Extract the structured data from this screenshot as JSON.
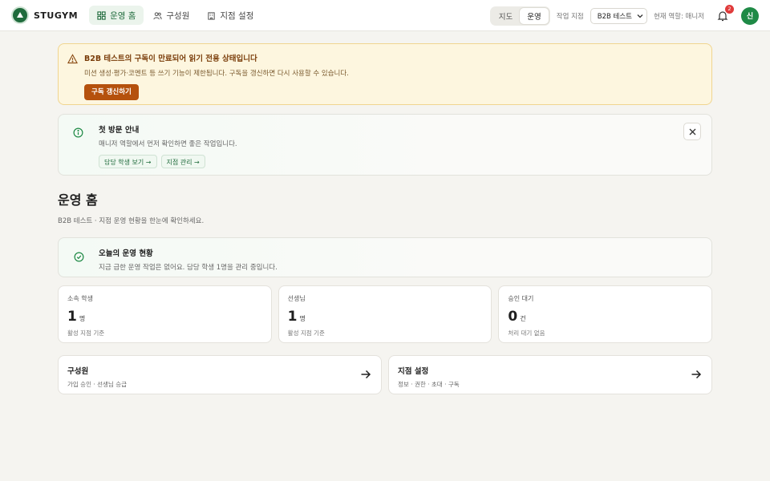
{
  "brand": {
    "name": "STUGYM"
  },
  "nav": {
    "items": [
      {
        "label": "운영 홈",
        "icon": "grid-icon",
        "active": true
      },
      {
        "label": "구성원",
        "icon": "users-icon",
        "active": false
      },
      {
        "label": "지점 설정",
        "icon": "building-icon",
        "active": false
      }
    ]
  },
  "header": {
    "mode_tabs": [
      "지도",
      "운영"
    ],
    "active_mode": "운영",
    "branch_label": "작업 지점",
    "branch_value": "B2B 테스트",
    "role_label": "현재 역할: 매니저",
    "notification_count": "2",
    "avatar_initial": "신"
  },
  "warning": {
    "title": "B2B 테스트의 구독이 만료되어 읽기 전용 상태입니다",
    "desc": "미션 생성·평가·코멘트 등 쓰기 기능이 제한됩니다. 구독을 갱신하면 다시 사용할 수 있습니다.",
    "button": "구독 갱신하기"
  },
  "guide": {
    "title": "첫 방문 안내",
    "desc": "매니저 역할에서 먼저 확인하면 좋은 작업입니다.",
    "chips": [
      "담당 학생 보기 →",
      "지점 관리 →"
    ]
  },
  "page": {
    "title": "운영 홈",
    "subtitle": "B2B 테스트 · 지점 운영 현황을 한눈에 확인하세요."
  },
  "status": {
    "title": "오늘의 운영 현황",
    "desc": "지금 급한 운영 작업은 없어요. 담당 학생 1명을 관리 중입니다."
  },
  "stats": [
    {
      "label": "소속 학생",
      "value": "1",
      "unit": "명",
      "note": "활성 지점 기준"
    },
    {
      "label": "선생님",
      "value": "1",
      "unit": "명",
      "note": "활성 지점 기준"
    },
    {
      "label": "승인 대기",
      "value": "0",
      "unit": "건",
      "note": "처리 대기 없음"
    }
  ],
  "links": [
    {
      "title": "구성원",
      "desc": "가입 승인 · 선생님 승급"
    },
    {
      "title": "지점 설정",
      "desc": "정보 · 권한 · 초대 · 구독"
    }
  ],
  "colors": {
    "brand": "#1f6b3c",
    "warning_button": "#b5510d",
    "badge": "#e03b3b"
  }
}
